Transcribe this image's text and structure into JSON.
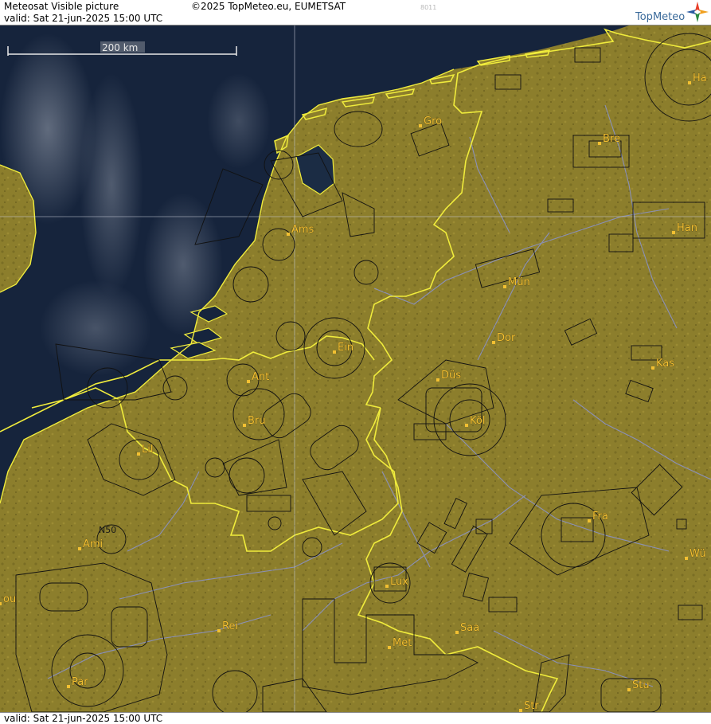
{
  "header": {
    "title": "Meteosat Visible picture",
    "valid": "valid:  Sat  21-jun-2025  15:00 UTC",
    "copyright": "©2025 TopMeteo.eu, EUMETSAT",
    "code": "8011",
    "brand": "TopMeteo"
  },
  "footer": {
    "valid": "valid:  Sat  21-jun-2025  15:00 UTC"
  },
  "map": {
    "scale_label": "200 km",
    "airspace_label": "N50",
    "colors": {
      "sea": "#16243c",
      "land": "#8c7e2c",
      "border": "#f0ec3c",
      "rivers": "#8a92c8",
      "airspace": "#111111",
      "city": "#f2c032"
    },
    "cities": [
      {
        "name": "Gro"
      },
      {
        "name": "Bre"
      },
      {
        "name": "Ha"
      },
      {
        "name": "Ams"
      },
      {
        "name": "Han"
      },
      {
        "name": "Mün"
      },
      {
        "name": "Ein"
      },
      {
        "name": "Dor"
      },
      {
        "name": "Kas"
      },
      {
        "name": "Ant"
      },
      {
        "name": "Düs"
      },
      {
        "name": "Bru"
      },
      {
        "name": "Köl"
      },
      {
        "name": "Lil"
      },
      {
        "name": "Fra"
      },
      {
        "name": "Ami"
      },
      {
        "name": "Wü"
      },
      {
        "name": "Lux"
      },
      {
        "name": "ou"
      },
      {
        "name": "Rei"
      },
      {
        "name": "Saa"
      },
      {
        "name": "Met"
      },
      {
        "name": "Par"
      },
      {
        "name": "Stu"
      },
      {
        "name": "Str"
      }
    ]
  }
}
